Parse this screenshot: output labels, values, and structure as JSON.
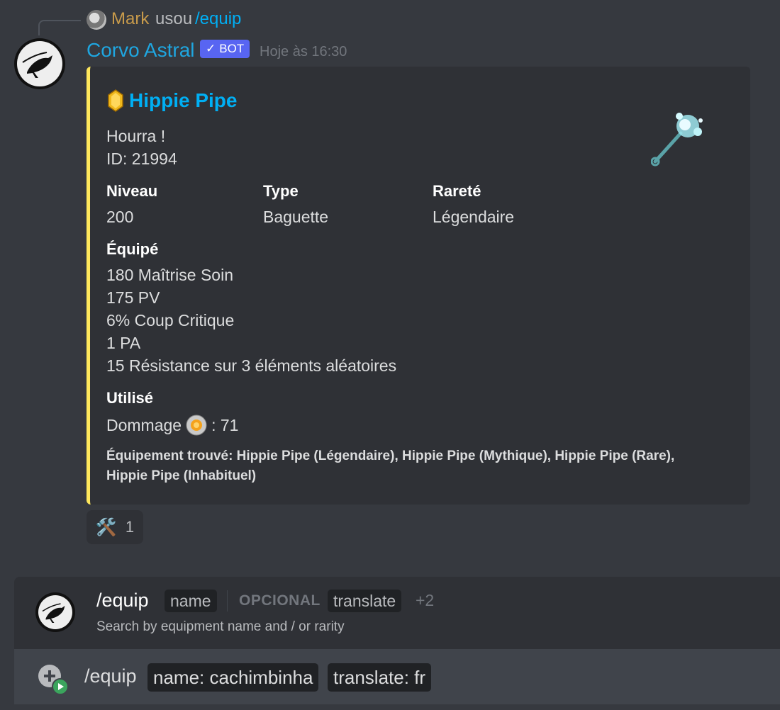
{
  "reply": {
    "user": "Mark",
    "action": "usou",
    "command": "/equip"
  },
  "message": {
    "author": "Corvo Astral",
    "bot_badge": "BOT",
    "timestamp": "Hoje às 16:30"
  },
  "embed": {
    "accent_color": "#fee75c",
    "title": "Hippie Pipe",
    "description_line1": "Hourra !",
    "description_line2": "ID: 21994",
    "fields": [
      {
        "name": "Niveau",
        "value": "200"
      },
      {
        "name": "Type",
        "value": "Baguette"
      },
      {
        "name": "Rareté",
        "value": "Légendaire"
      }
    ],
    "equipped_title": "Équipé",
    "equipped": [
      "180 Maîtrise Soin",
      "175 PV",
      "6% Coup Critique",
      "1 PA",
      "15 Résistance sur 3 éléments aléatoires"
    ],
    "used_title": "Utilisé",
    "used_damage_label": "Dommage",
    "used_damage_value": ": 71",
    "found": "Équipement trouvé: Hippie Pipe (Légendaire), Hippie Pipe (Mythique), Hippie Pipe (Rare), Hippie Pipe (Inhabituel)"
  },
  "reaction": {
    "emoji": "🛠️",
    "count": "1"
  },
  "command_helper": {
    "name": "/equip",
    "param1": "name",
    "optional_label": "OPCIONAL",
    "param2": "translate",
    "more": "+2",
    "description": "Search by equipment name and / or rarity"
  },
  "input": {
    "command": "/equip",
    "chip1": "name: cachimbinha",
    "chip2": "translate: fr"
  }
}
